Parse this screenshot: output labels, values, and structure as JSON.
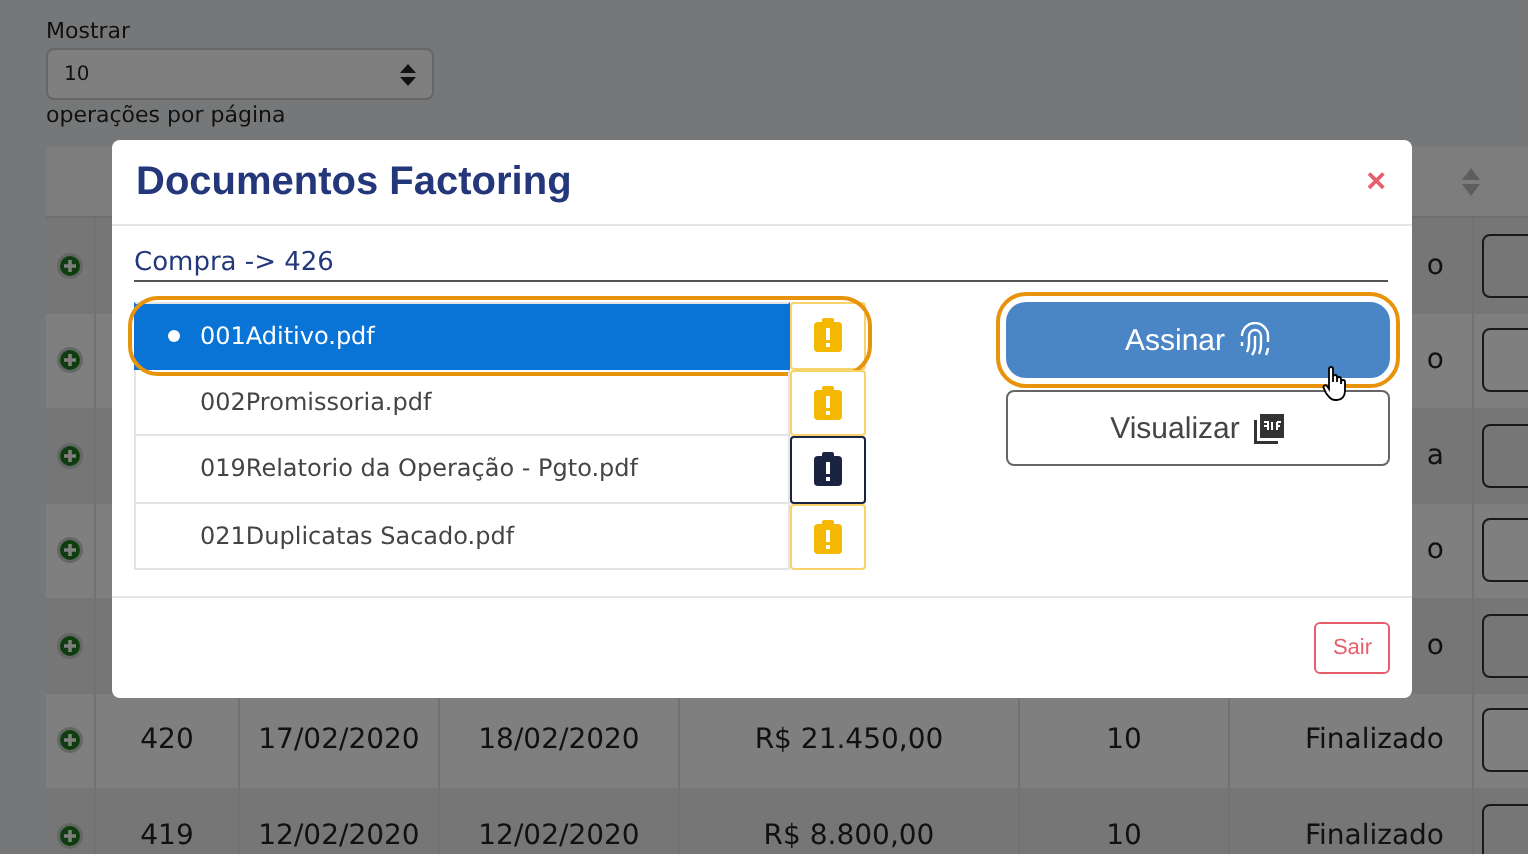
{
  "page": {
    "show_label": "Mostrar",
    "page_size": "10",
    "per_page_label": "operações por página"
  },
  "table": {
    "rows": [
      {
        "status": "o"
      },
      {
        "status": "o"
      },
      {
        "status": "a"
      },
      {
        "status": "o"
      },
      {
        "status": "o"
      },
      {
        "id": "420",
        "date_1": "17/02/2020",
        "date_2": "18/02/2020",
        "value": "R$ 21.450,00",
        "quantity": "10",
        "status": "Finalizado"
      },
      {
        "id": "419",
        "date_1": "12/02/2020",
        "date_2": "12/02/2020",
        "value": "R$ 8.800,00",
        "quantity": "10",
        "status": "Finalizado"
      }
    ]
  },
  "modal": {
    "title": "Documentos Factoring",
    "close": "×",
    "subtitle": "Compra -> 426",
    "documents": [
      {
        "name": "001Aditivo.pdf",
        "selected": true,
        "highlighted": true,
        "focused": false
      },
      {
        "name": "002Promissoria.pdf",
        "selected": false,
        "highlighted": false,
        "focused": false
      },
      {
        "name": "019Relatorio da Operação - Pgto.pdf",
        "selected": false,
        "highlighted": false,
        "focused": true
      },
      {
        "name": "021Duplicatas Sacado.pdf",
        "selected": false,
        "highlighted": false,
        "focused": false
      }
    ],
    "buttons": [
      {
        "kind": "sign",
        "label": "Assinar",
        "highlighted": true
      },
      {
        "kind": "view",
        "label": "Visualizar",
        "highlighted": false
      }
    ],
    "exit": "Sair"
  }
}
